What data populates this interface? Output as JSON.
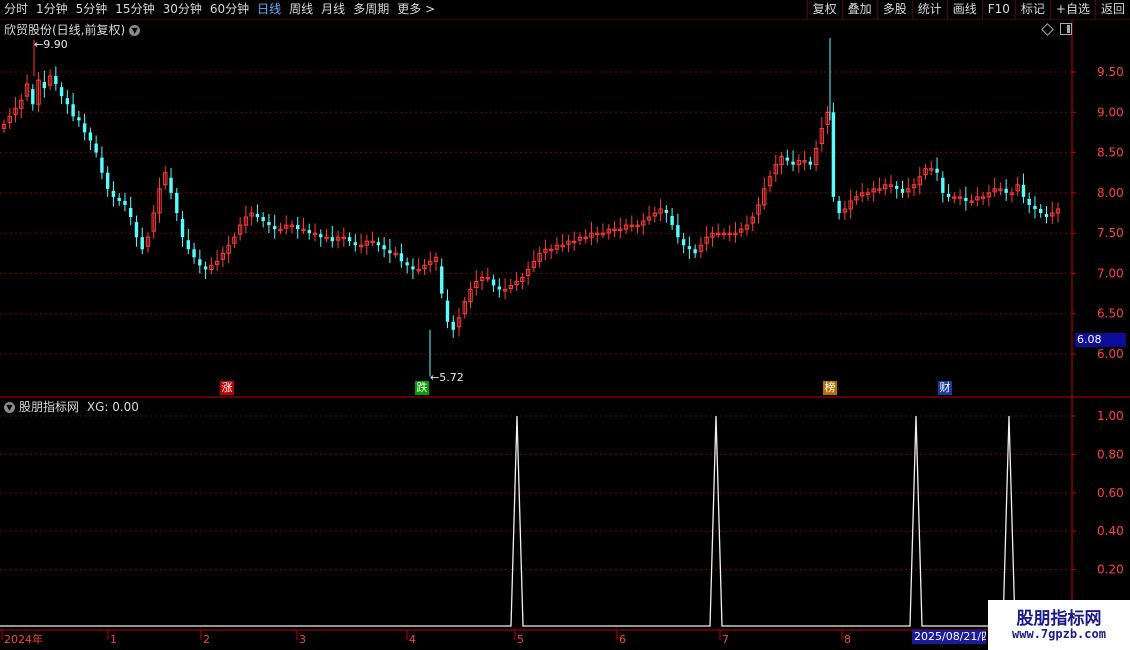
{
  "toolbar": {
    "periods": [
      "分时",
      "1分钟",
      "5分钟",
      "15分钟",
      "30分钟",
      "60分钟",
      "日线",
      "周线",
      "月线",
      "多周期",
      "更多 >"
    ],
    "active_period": "日线",
    "tools": [
      "复权",
      "叠加",
      "多股",
      "统计",
      "画线",
      "F10",
      "标记",
      "+自选",
      "返回"
    ]
  },
  "main_chart": {
    "title": "欣贸股份(日线,前复权)",
    "high_label": "9.90",
    "low_label": "5.72",
    "current_price_tag": "6.08",
    "yaxis": [
      "9.50",
      "9.00",
      "8.50",
      "8.00",
      "7.50",
      "7.00",
      "6.50",
      "6.00"
    ],
    "badges": [
      {
        "text": "涨",
        "color": "#c00000"
      },
      {
        "text": "跌",
        "color": "#00a000"
      },
      {
        "text": "榜",
        "color": "#b87000"
      },
      {
        "text": "财",
        "color": "#1a3aa0"
      }
    ],
    "colors": {
      "up": "#ff3c3c",
      "down": "#54ffff",
      "grid": "#7a0000",
      "axis": "#c00000"
    }
  },
  "indicator": {
    "title": "股朋指标网",
    "value_label": "XG: 0.00",
    "yaxis": [
      "1.00",
      "0.80",
      "0.60",
      "0.40",
      "0.20"
    ]
  },
  "xaxis": {
    "labels": [
      "2024年",
      "1",
      "2",
      "3",
      "4",
      "5",
      "6",
      "7",
      "8"
    ],
    "current_date": "2025/08/21/四"
  },
  "chart_data": [
    {
      "type": "line",
      "title": "欣贸股份(日线,前复权)",
      "x_range": [
        "2024年12月",
        "2025年8月"
      ],
      "ylim": [
        5.5,
        10.0
      ],
      "y_ticks": [
        6.0,
        6.5,
        7.0,
        7.5,
        8.0,
        8.5,
        9.0,
        9.5
      ],
      "annotations": [
        {
          "label": "9.90",
          "kind": "max"
        },
        {
          "label": "5.72",
          "kind": "min"
        }
      ],
      "series": [
        {
          "values": [
            8.85,
            8.95,
            9.05,
            9.15,
            9.35,
            9.1,
            9.4,
            9.3,
            9.45,
            9.35,
            9.2,
            9.1,
            8.95,
            8.9,
            8.75,
            8.65,
            8.5,
            8.25,
            8.05,
            7.95,
            7.9,
            7.85,
            7.7,
            7.45,
            7.3,
            7.45,
            7.75,
            8.05,
            8.25,
            8.0,
            7.75,
            7.45,
            7.3,
            7.2,
            7.1,
            7.05,
            7.1,
            7.15,
            7.25,
            7.35,
            7.45,
            7.6,
            7.7,
            7.75,
            7.7,
            7.65,
            7.6,
            7.55,
            7.55,
            7.6,
            7.6,
            7.55,
            7.55,
            7.5,
            7.5,
            7.45,
            7.45,
            7.4,
            7.45,
            7.45,
            7.4,
            7.35,
            7.35,
            7.4,
            7.4,
            7.35,
            7.3,
            7.25,
            7.25,
            7.15,
            7.1,
            7.05,
            7.05,
            7.1,
            7.15,
            7.2,
            6.75,
            6.4,
            6.3,
            6.45,
            6.65,
            6.8,
            6.9,
            6.95,
            6.95,
            6.85,
            6.8,
            6.8,
            6.85,
            6.9,
            6.95,
            7.05,
            7.15,
            7.25,
            7.3,
            7.3,
            7.35,
            7.35,
            7.4,
            7.4,
            7.45,
            7.45,
            7.5,
            7.5,
            7.5,
            7.55,
            7.55,
            7.55,
            7.6,
            7.6,
            7.6,
            7.65,
            7.7,
            7.75,
            7.8,
            7.75,
            7.6,
            7.45,
            7.35,
            7.3,
            7.25,
            7.35,
            7.45,
            7.5,
            7.5,
            7.5,
            7.5,
            7.5,
            7.55,
            7.6,
            7.7,
            7.85,
            8.05,
            8.2,
            8.35,
            8.45,
            8.4,
            8.35,
            8.4,
            8.4,
            8.35,
            8.55,
            8.8,
            9.0,
            7.95,
            7.75,
            7.8,
            7.9,
            7.95,
            8.0,
            8.0,
            8.05,
            8.05,
            8.1,
            8.1,
            8.05,
            8.0,
            8.05,
            8.1,
            8.2,
            8.3,
            8.3,
            8.25,
            8.0,
            7.95,
            7.95,
            7.95,
            7.9,
            7.9,
            7.95,
            7.95,
            8.0,
            8.05,
            8.05,
            8.0,
            8.0,
            8.1,
            7.95,
            7.85,
            7.8,
            7.75,
            7.7,
            7.75,
            7.8
          ]
        }
      ]
    },
    {
      "type": "line",
      "title": "股朋指标网",
      "ylim": [
        0,
        1.0
      ],
      "y_ticks": [
        0.2,
        0.4,
        0.6,
        0.8,
        1.0
      ],
      "series": [
        {
          "name": "XG",
          "x": [
            "5月",
            "7月",
            "8月下旬",
            "9月"
          ],
          "values": [
            1,
            1,
            1,
            1
          ],
          "baseline": 0
        }
      ]
    }
  ],
  "watermark": {
    "line1": "股朋指标网",
    "line2": "www.7gpzb.com"
  }
}
